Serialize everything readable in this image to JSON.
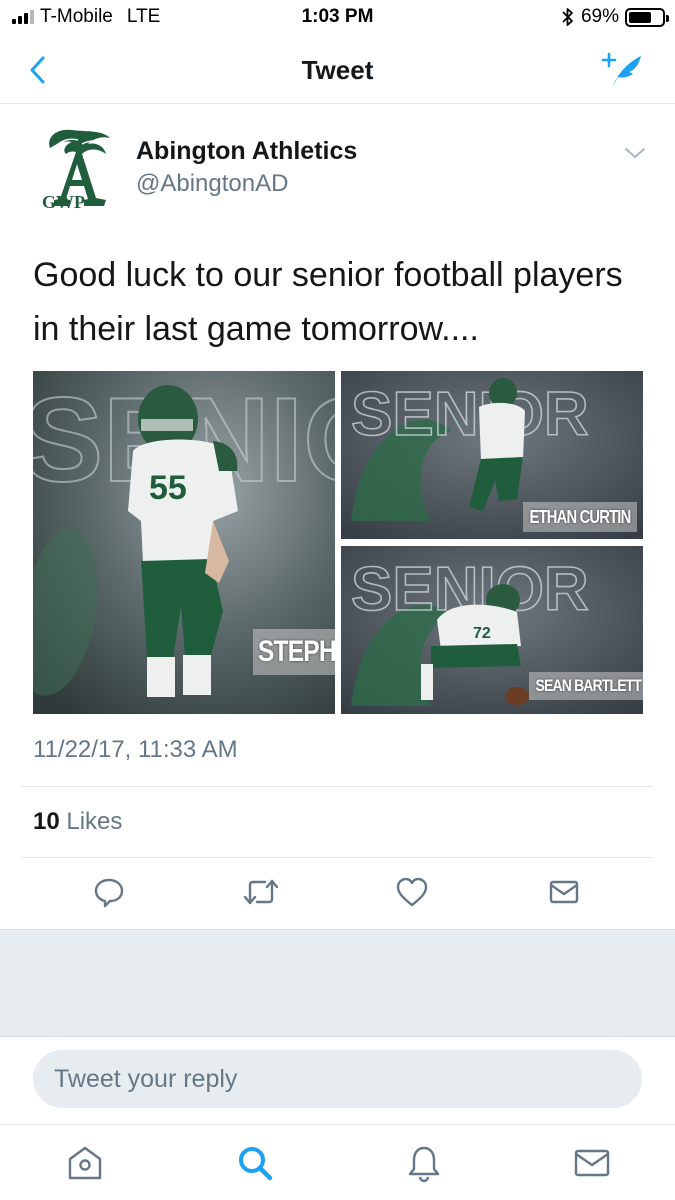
{
  "status_bar": {
    "carrier": "T-Mobile",
    "network": "LTE",
    "time": "1:03 PM",
    "battery_percent": "69%",
    "battery_level": 0.69,
    "signal_bars": 3
  },
  "nav": {
    "title": "Tweet",
    "back_icon": "chevron-left-icon",
    "compose_icon": "compose-tweet-icon"
  },
  "tweet": {
    "author_name": "Abington Athletics",
    "author_handle": "@AbingtonAD",
    "avatar_text": "GWP",
    "text": "Good luck to our senior football players in their last game tomorrow....",
    "media": [
      {
        "name_plate": "STEPH",
        "jersey": "55",
        "banner": "SENIOR"
      },
      {
        "name_plate": "ETHAN CURTIN",
        "banner": "SENIOR"
      },
      {
        "name_plate": "SEAN BARTLETT",
        "jersey": "72",
        "banner": "SENIOR"
      }
    ],
    "timestamp": "11/22/17, 11:33 AM",
    "likes_count": "10",
    "likes_label": "Likes"
  },
  "actions": [
    {
      "name": "reply-button",
      "icon": "reply-icon"
    },
    {
      "name": "retweet-button",
      "icon": "retweet-icon"
    },
    {
      "name": "like-button",
      "icon": "heart-icon"
    },
    {
      "name": "share-button",
      "icon": "envelope-icon"
    }
  ],
  "reply": {
    "placeholder": "Tweet your reply"
  },
  "tabs": [
    {
      "name": "home",
      "icon": "home-icon",
      "active": false
    },
    {
      "name": "search",
      "icon": "search-icon",
      "active": true
    },
    {
      "name": "notifications",
      "icon": "bell-icon",
      "active": false
    },
    {
      "name": "messages",
      "icon": "envelope-icon",
      "active": false
    }
  ],
  "colors": {
    "accent": "#1da1f2",
    "text_primary": "#14171a",
    "text_secondary": "#657786",
    "divider": "#e1e8ed",
    "gap_background": "#e6ecf0",
    "team_green": "#1f5d3c"
  }
}
